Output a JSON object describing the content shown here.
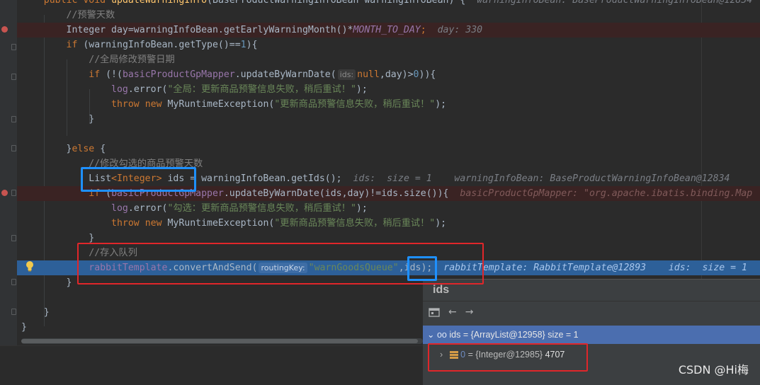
{
  "editor": {
    "line0": {
      "kw1": "public",
      "kw2": "void",
      "method": "updateWarningInfo",
      "params": "(BaseProductWarningInfoBean warningInfoBean) {",
      "debug": "warningInfoBean: BaseProductWarningInfoBean@12834"
    },
    "line1": {
      "comment": "//预警天数"
    },
    "line2": {
      "type": "Integer",
      "text": " day=warningInfoBean.getEarlyWarningMonth()*",
      "const": "MONTH_TO_DAY",
      "semi": ";",
      "debug": "day: 330"
    },
    "line3": {
      "kw": "if",
      "text": " (warningInfoBean.getType()==",
      "num": "1",
      "end": "){"
    },
    "line4": {
      "comment": "//全局修改预警日期"
    },
    "line5": {
      "kw": "if",
      "pre": " (!(",
      "field": "basicProductGpMapper",
      "call": ".updateByWarnDate(",
      "hint": "ids:",
      "kwnull": "null",
      "post": ",day)>",
      "num": "0",
      "end": ")){"
    },
    "line6": {
      "field": "log",
      "call": ".error(",
      "str": "\"全局：更新商品预警信息失败，稍后重试！\"",
      "end": ");"
    },
    "line7": {
      "kw1": "throw",
      "kw2": "new",
      "cls": " MyRuntimeException(",
      "str": "\"更新商品预警信息失败，稍后重试！\"",
      "end": ");"
    },
    "line8": {
      "brace": "}"
    },
    "line10": {
      "brace": "}",
      "kw": "else",
      "brace2": " {"
    },
    "line11": {
      "comment": "//修改勾选的商品预警天数"
    },
    "line12": {
      "type": "List",
      "generic": "<Integer>",
      "var": " ids",
      "text": " = warningInfoBean.getIds();",
      "debug1": "ids:  size = 1",
      "debug2": "warningInfoBean: BaseProductWarningInfoBean@12834"
    },
    "line13": {
      "kw": "if",
      "pre": " (",
      "field": "basicProductGpMapper",
      "call": ".updateByWarnDate(",
      "var": "ids",
      "mid": ",day)!=",
      "var2": "ids",
      "post": ".size()){",
      "debug": "basicProductGpMapper: \"org.apache.ibatis.binding.Map"
    },
    "line14": {
      "field": "log",
      "call": ".error(",
      "str": "\"勾选：更新商品预警信息失败，稍后重试！\"",
      "end": ");"
    },
    "line15": {
      "kw1": "throw",
      "kw2": "new",
      "cls": " MyRuntimeException(",
      "str": "\"更新商品预警信息失败，稍后重试！\"",
      "end": ");"
    },
    "line16": {
      "brace": "}"
    },
    "line17": {
      "comment": "//存入队列"
    },
    "line18": {
      "field": "rabbitTemplate",
      "call": ".convertAndSend(",
      "hint": "routingKey:",
      "str": "\"warnGoodsQueue\"",
      "comma": ",",
      "var": "ids",
      "end": ");",
      "debug1": "rabbitTemplate: RabbitTemplate@12893",
      "debug2": "ids:  size = 1"
    },
    "line19": {
      "brace": "}"
    },
    "line21": {
      "brace": "}"
    },
    "line22": {
      "brace": "}"
    }
  },
  "popup": {
    "title": "ids",
    "root": {
      "name": "ids",
      "value": "= {ArrayList@12958}",
      "size": "size = 1"
    },
    "child": {
      "index": "0",
      "value": "= {Integer@12985}",
      "number": "4707"
    }
  },
  "watermark": "CSDN @Hi梅",
  "colors": {
    "annotation_red": "#e0262a",
    "annotation_blue": "#1e90ff"
  }
}
